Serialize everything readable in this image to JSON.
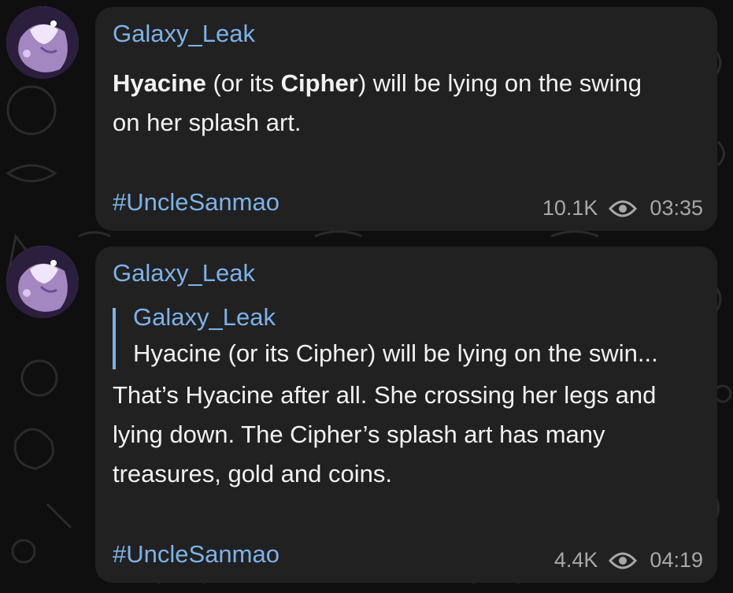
{
  "messages": [
    {
      "sender": "Galaxy_Leak",
      "body_bold_1": "Hyacine",
      "body_part_1": " (or its ",
      "body_bold_2": "Cipher",
      "body_part_2": ") will be lying on the swing",
      "body_line_2": "on her splash art.",
      "hashtag": "#UncleSanmao",
      "views": "10.1K",
      "time": "03:35",
      "avatar_icon": "avatar-image",
      "views_icon": "eye-icon"
    },
    {
      "sender": "Galaxy_Leak",
      "reply": {
        "sender": "Galaxy_Leak",
        "text": "Hyacine (or its Cipher) will be lying on the swin..."
      },
      "body_line_1": "That’s Hyacine after all. She crossing her legs and",
      "body_line_2": "lying down. The Cipher’s splash art has many",
      "body_line_3": "treasures, gold and coins.",
      "hashtag": "#UncleSanmao",
      "views": "4.4K",
      "time": "04:19",
      "avatar_icon": "avatar-image",
      "views_icon": "eye-icon"
    }
  ],
  "colors": {
    "background": "#0f0f10",
    "bubble": "#212121",
    "accent": "#7db2e8",
    "text": "#f2f2f2",
    "meta": "#a8a8a8"
  }
}
